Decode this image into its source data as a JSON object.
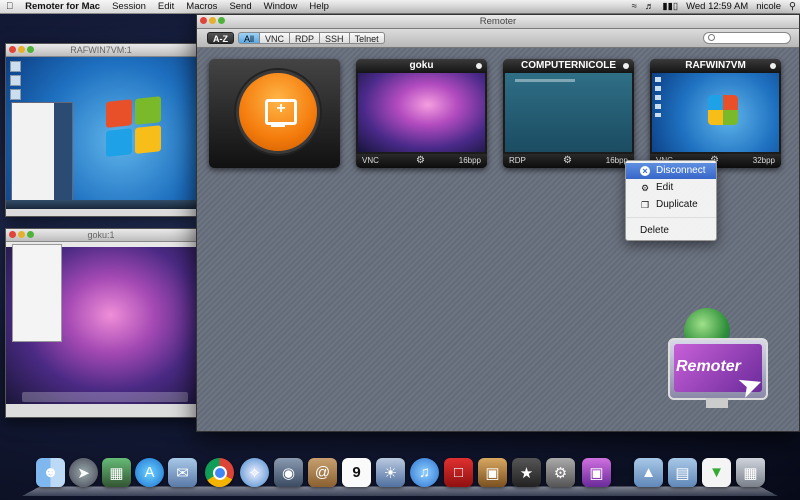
{
  "menubar": {
    "apple": "",
    "app_name": "Remoter for Mac",
    "items": [
      "Session",
      "Edit",
      "Macros",
      "Send",
      "Window",
      "Help"
    ],
    "clock": "Wed 12:59 AM",
    "user": "nicole"
  },
  "vm_windows": [
    {
      "title": "RAFWIN7VM:1"
    },
    {
      "title": "goku:1"
    }
  ],
  "remoter": {
    "title": "Remoter",
    "sort_button": "A-Z",
    "filters": [
      "All",
      "VNC",
      "RDP",
      "SSH",
      "Telnet"
    ],
    "selected_filter": "All",
    "search_placeholder": "",
    "sessions": [
      {
        "name": "goku",
        "protocol": "VNC",
        "depth": "16bpp"
      },
      {
        "name": "COMPUTERNICOLE",
        "protocol": "RDP",
        "depth": "16bpp"
      },
      {
        "name": "RAFWIN7VM",
        "protocol": "VNC",
        "depth": "32bpp"
      }
    ]
  },
  "context_menu": {
    "items": [
      {
        "label": "Disconnect",
        "icon": "disconnect-icon"
      },
      {
        "label": "Edit",
        "icon": "edit-icon"
      },
      {
        "label": "Duplicate",
        "icon": "duplicate-icon"
      },
      {
        "label": "Delete",
        "icon": ""
      }
    ],
    "highlighted": "Disconnect"
  },
  "logo_text": "Remoter",
  "dock": {
    "apps": [
      "Finder",
      "Launchpad",
      "Mission Control",
      "App Store",
      "Preview",
      "Chrome",
      "Safari",
      "FaceTime",
      "Address Book",
      "iCal",
      "iPhoto",
      "iTunes",
      "Photo Booth",
      "Image Capture",
      "iMovie",
      "System Preferences",
      "Remoter",
      "Applications",
      "Documents",
      "Downloads",
      "Trash"
    ],
    "ical_date": "9"
  },
  "colors": {
    "accent_orange": "#f47b0c",
    "selected_filter": "#5aa8e4",
    "menu_highlight": "#3766c9"
  }
}
